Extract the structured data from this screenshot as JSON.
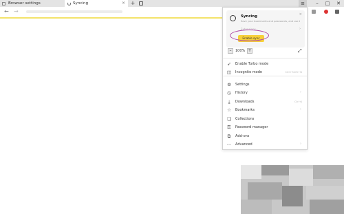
{
  "tabs": [
    {
      "title": "Browser settings",
      "active": false
    },
    {
      "title": "Syncing",
      "active": true
    }
  ],
  "tabbar": {
    "new_tab": "+"
  },
  "window": {
    "menu": "≡",
    "minimize": "–",
    "maximize": "□",
    "close": "✕"
  },
  "nav": {
    "back": "←",
    "forward": "→"
  },
  "menu": {
    "sync": {
      "title": "Syncing",
      "subtitle": "Save your bookmarks and passwords, and use them on all your devices",
      "link": "Extensions",
      "button": "Enable sync",
      "close": "×"
    },
    "zoom": {
      "minus": "–",
      "value": "100%",
      "plus": "+"
    },
    "items": [
      {
        "label": "Enable Turbo mode",
        "icon": "rocket-icon",
        "hint": ""
      },
      {
        "label": "Incognito mode",
        "icon": "mask-icon",
        "hint": "Ctrl+Shift+N"
      },
      {
        "label": "Settings",
        "icon": "gear-icon",
        "hint": ""
      },
      {
        "label": "History",
        "icon": "clock-icon",
        "hint": "›"
      },
      {
        "label": "Downloads",
        "icon": "download-icon",
        "hint": "Ctrl+J"
      },
      {
        "label": "Bookmarks",
        "icon": "star-icon",
        "hint": "›"
      },
      {
        "label": "Collections",
        "icon": "collection-icon",
        "hint": ""
      },
      {
        "label": "Password manager",
        "icon": "key-icon",
        "hint": ""
      },
      {
        "label": "Add-ons",
        "icon": "puzzle-icon",
        "hint": ""
      },
      {
        "label": "Advanced",
        "icon": "more-icon",
        "hint": "›"
      }
    ]
  },
  "colors": {
    "accent": "#f6cf3a",
    "highlight": "#b04aa6",
    "progress": "#f3e36a"
  }
}
